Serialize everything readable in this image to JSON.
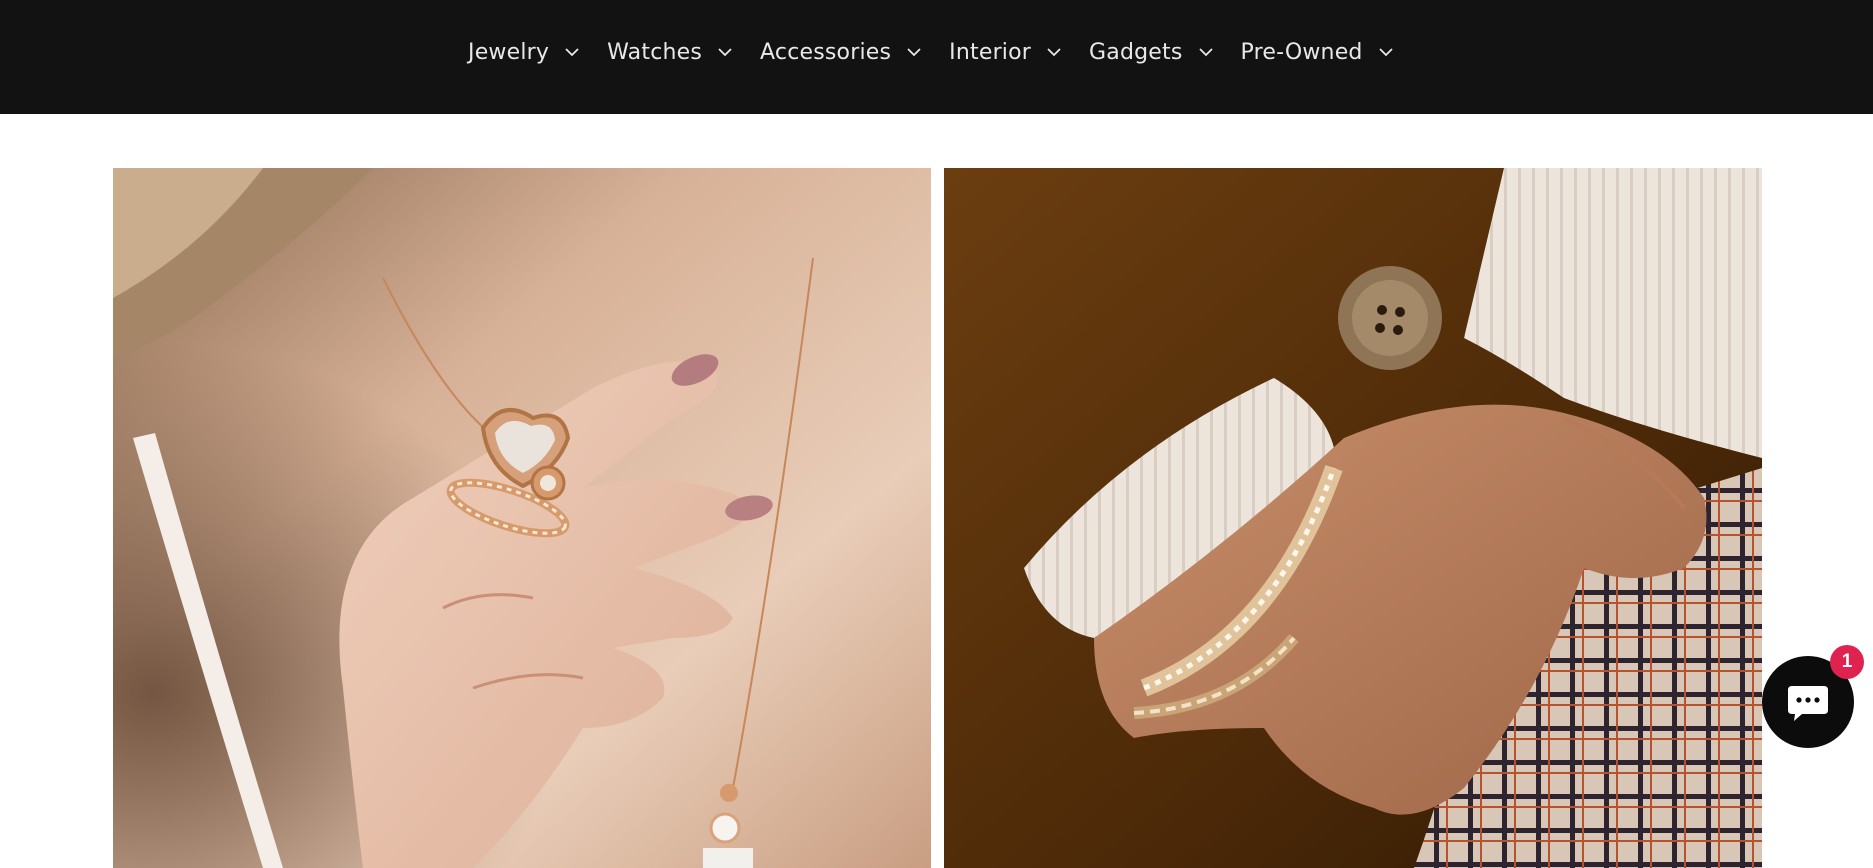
{
  "nav": {
    "items": [
      {
        "label": "Jewelry",
        "icon": "chevron-down-icon"
      },
      {
        "label": "Watches",
        "icon": "chevron-down-icon"
      },
      {
        "label": "Accessories",
        "icon": "chevron-down-icon"
      },
      {
        "label": "Interior",
        "icon": "chevron-down-icon"
      },
      {
        "label": "Gadgets",
        "icon": "chevron-down-icon"
      },
      {
        "label": "Pre-Owned",
        "icon": "chevron-down-icon"
      }
    ]
  },
  "tiles": [
    {
      "subject": "hand with rose-gold heart ring and necklace"
    },
    {
      "subject": "wrist with gold bracelet and plaid pocket"
    }
  ],
  "chat": {
    "icon": "chat-bubble-icon",
    "badge_count": "1"
  },
  "colors": {
    "nav_background": "#121212",
    "nav_text": "#e8e8e8",
    "badge": "#e0224e"
  }
}
